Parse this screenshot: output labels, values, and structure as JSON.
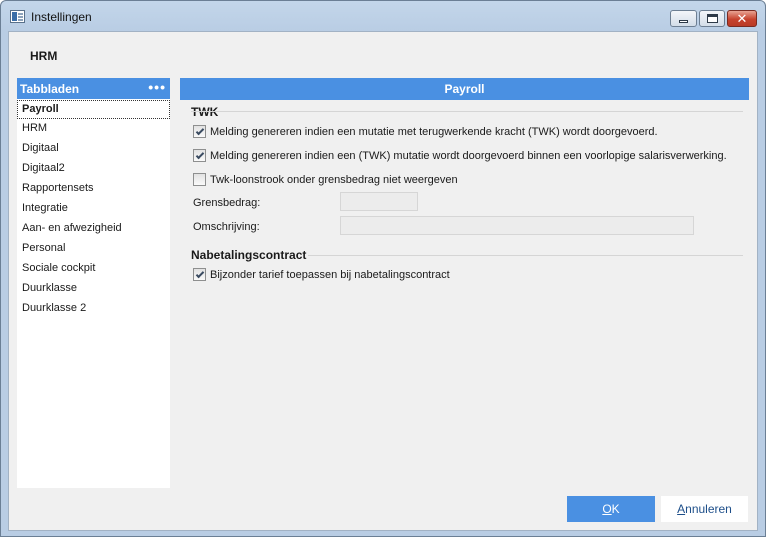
{
  "window": {
    "title": "Instellingen",
    "icons": [
      "app-window-icon",
      "minimize-icon",
      "maximize-icon",
      "close-icon"
    ]
  },
  "page_title": "HRM",
  "sidebar": {
    "header": "Tabbladen",
    "menu_glyph": "•••",
    "items": [
      {
        "label": "Payroll",
        "active": true
      },
      {
        "label": "HRM"
      },
      {
        "label": "Digitaal"
      },
      {
        "label": "Digitaal2"
      },
      {
        "label": "Rapportensets"
      },
      {
        "label": "Integratie"
      },
      {
        "label": "Aan- en afwezigheid"
      },
      {
        "label": "Personal"
      },
      {
        "label": "Sociale cockpit"
      },
      {
        "label": "Duurklasse"
      },
      {
        "label": "Duurklasse 2"
      }
    ]
  },
  "panel": {
    "title": "Payroll",
    "twk": {
      "title": "TWK",
      "options": [
        {
          "label": "Melding genereren indien een mutatie met terugwerkende kracht (TWK) wordt doorgevoerd.",
          "checked": true
        },
        {
          "label": "Melding genereren indien een (TWK) mutatie wordt doorgevoerd binnen een voorlopige salarisverwerking.",
          "checked": true
        },
        {
          "label": "Twk-loonstrook onder grensbedrag niet weergeven",
          "checked": false
        }
      ],
      "grensbedrag_label": "Grensbedrag:",
      "grensbedrag_value": "",
      "omschrijving_label": "Omschrijving:",
      "omschrijving_value": ""
    },
    "nabetaling": {
      "title": "Nabetalingscontract",
      "options": [
        {
          "label": "Bijzonder tarief toepassen bij nabetalingscontract",
          "checked": true
        }
      ]
    }
  },
  "footer": {
    "ok_label": "OK",
    "cancel_label": "Annuleren"
  },
  "colors": {
    "accent": "#4a90e2",
    "window_frame": "#b9cde4",
    "client_bg": "#f0f0f0"
  }
}
